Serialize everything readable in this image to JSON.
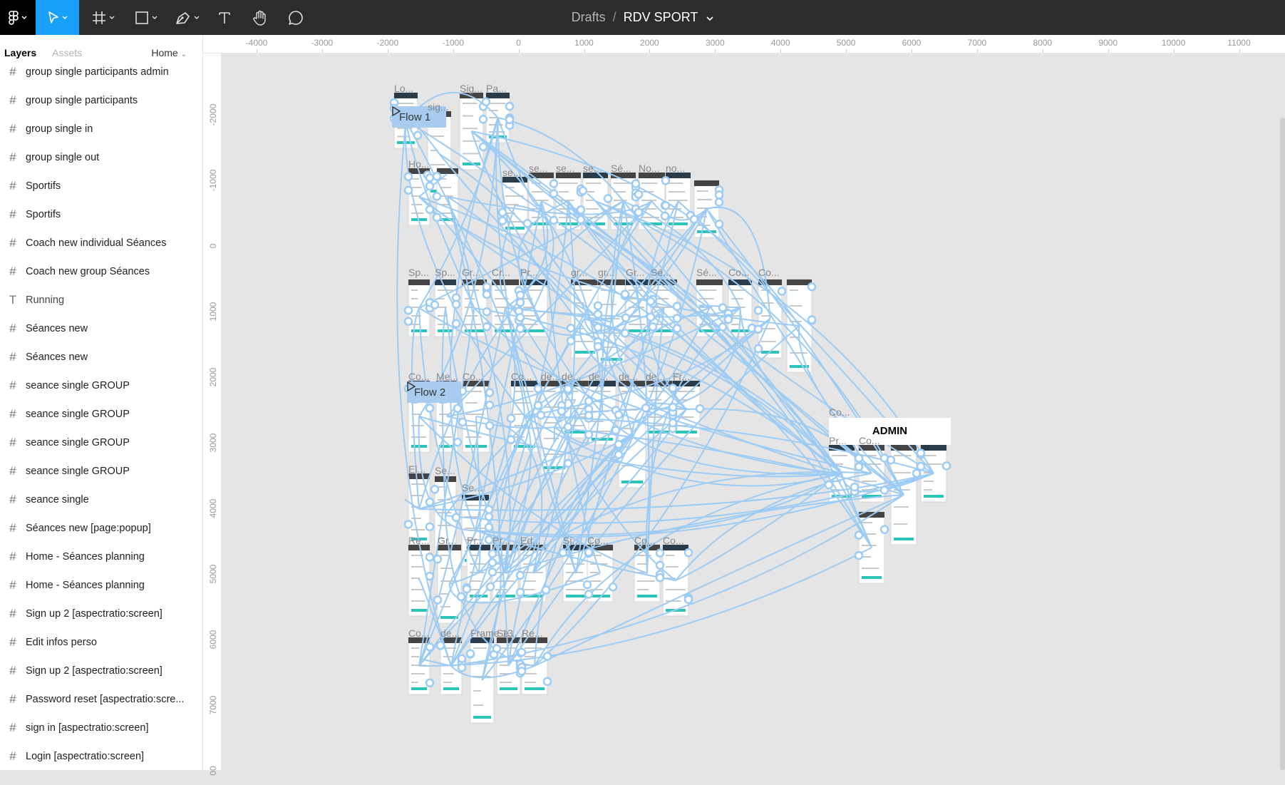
{
  "toolbar": {
    "tools": [
      {
        "name": "figma-menu-icon",
        "has_caret": true
      },
      {
        "name": "move-tool-icon",
        "has_caret": true,
        "active": true
      },
      {
        "name": "frame-tool-icon",
        "has_caret": true
      },
      {
        "name": "shape-tool-icon",
        "has_caret": true
      },
      {
        "name": "pen-tool-icon",
        "has_caret": true
      },
      {
        "name": "text-tool-icon",
        "has_caret": false
      },
      {
        "name": "hand-tool-icon",
        "has_caret": false
      },
      {
        "name": "comment-tool-icon",
        "has_caret": false
      }
    ],
    "breadcrumb": {
      "folder": "Drafts",
      "separator": "/",
      "file": "RDV SPORT"
    }
  },
  "panel": {
    "tabs": [
      {
        "label": "Layers",
        "active": true
      },
      {
        "label": "Assets",
        "active": false
      }
    ],
    "page": "Home",
    "layers": [
      {
        "icon": "frame",
        "name": "group single participants admin"
      },
      {
        "icon": "frame",
        "name": "group single participants"
      },
      {
        "icon": "frame",
        "name": "group single in"
      },
      {
        "icon": "frame",
        "name": "group single out"
      },
      {
        "icon": "frame",
        "name": "Sportifs"
      },
      {
        "icon": "frame",
        "name": "Sportifs"
      },
      {
        "icon": "frame",
        "name": "Coach  new individual Séances"
      },
      {
        "icon": "frame",
        "name": "Coach  new group Séances"
      },
      {
        "icon": "text",
        "name": "Running"
      },
      {
        "icon": "frame",
        "name": "Séances new"
      },
      {
        "icon": "frame",
        "name": "Séances new"
      },
      {
        "icon": "frame",
        "name": "seance single GROUP"
      },
      {
        "icon": "frame",
        "name": "seance single GROUP"
      },
      {
        "icon": "frame",
        "name": "seance single GROUP"
      },
      {
        "icon": "frame",
        "name": "seance single GROUP"
      },
      {
        "icon": "frame",
        "name": "seance single"
      },
      {
        "icon": "frame",
        "name": "Séances new [page:popup]"
      },
      {
        "icon": "frame",
        "name": "Home - Séances planning"
      },
      {
        "icon": "frame",
        "name": "Home - Séances planning"
      },
      {
        "icon": "frame",
        "name": "Sign up 2 [aspectratio:screen]"
      },
      {
        "icon": "frame",
        "name": "Edit infos perso"
      },
      {
        "icon": "frame",
        "name": "Sign up 2 [aspectratio:screen]"
      },
      {
        "icon": "frame",
        "name": "Password reset  [aspectratio:scre..."
      },
      {
        "icon": "frame",
        "name": "sign in  [aspectratio:screen]"
      },
      {
        "icon": "frame",
        "name": "Login [aspectratio:screen]"
      }
    ]
  },
  "rulers": {
    "top": [
      "-4000",
      "-3000",
      "-2000",
      "-1000",
      "0",
      "1000",
      "2000",
      "3000",
      "4000",
      "5000",
      "6000",
      "7000",
      "8000",
      "9000",
      "10000",
      "11000"
    ],
    "left": [
      "-2000",
      "-1000",
      "0",
      "1000",
      "2000",
      "3000",
      "4000",
      "5000",
      "6000",
      "7000",
      "00"
    ]
  },
  "canvas": {
    "flows": [
      {
        "label": "Flow 1"
      },
      {
        "label": "Flow 2"
      }
    ],
    "frame_labels": [
      "Lo...",
      "sig...",
      "Sig...",
      "Pa...",
      "Ho...",
      "se...",
      "se...",
      "se...",
      "se...",
      "Sé...",
      "No...",
      "no...",
      "Sp...",
      "Sp...",
      "Gr...",
      "Cr...",
      "Pr...",
      "gr...",
      "gr...",
      "Gr...",
      "Sé...",
      "Sé...",
      "Co...",
      "Co...",
      "Co...",
      "Me...",
      "Co...",
      "Co...",
      "de...",
      "de...",
      "de...",
      "de...",
      "de...",
      "Fr...",
      "El...",
      "Se...",
      "Se...",
      "Re...",
      "Gr...",
      "Pr...",
      "Pr...",
      "Ed...",
      "Si...",
      "Co...",
      "Co...",
      "Co...",
      "Co...",
      "de...",
      "Frame 13",
      "Se...",
      "Re...",
      "Co...",
      "Pr...",
      "Co..."
    ],
    "admin_title": "ADMIN",
    "accent": "#18a0fb",
    "flow_color": "#a7ccef",
    "connector_color": "#9ccbf4",
    "teal": "#2bc4b8"
  }
}
